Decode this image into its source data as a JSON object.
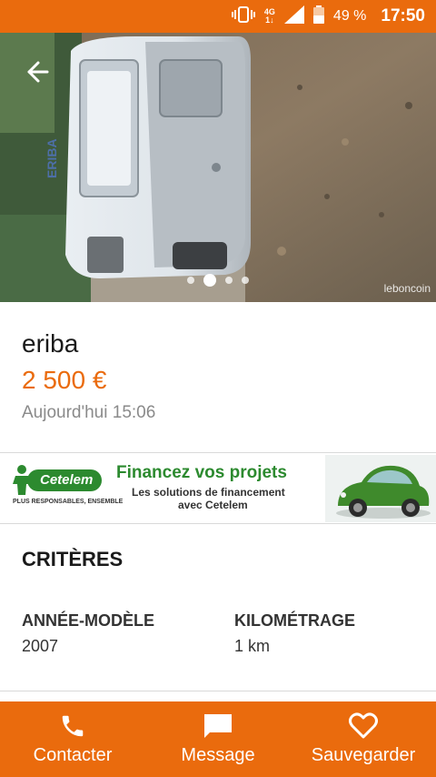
{
  "status_bar": {
    "network_top": "4G",
    "network_bottom": "1↓",
    "battery": "49 %",
    "time": "17:50"
  },
  "photo": {
    "watermark": "leboncoin",
    "caravan_brand": "ERIBA",
    "dots": 4,
    "active_dot": 1
  },
  "listing": {
    "title": "eriba",
    "price": "2 500 €",
    "date": "Aujourd'hui 15:06"
  },
  "ad": {
    "brand": "Cetelem",
    "tagline": "PLUS RESPONSABLES, ENSEMBLE",
    "headline": "Financez vos projets",
    "sub1": "Les solutions de financement",
    "sub2": "avec Cetelem"
  },
  "criteria": {
    "title": "CRITÈRES",
    "items": [
      {
        "label": "ANNÉE-MODÈLE",
        "value": "2007"
      },
      {
        "label": "KILOMÉTRAGE",
        "value": "1 km"
      }
    ]
  },
  "actions": {
    "contact": "Contacter",
    "message": "Message",
    "save": "Sauvegarder"
  },
  "icons": {
    "back": "back-arrow-icon",
    "vibrate": "vibrate-icon",
    "signal": "signal-icon",
    "battery": "battery-icon",
    "phone": "phone-icon",
    "message": "message-icon",
    "heart": "heart-icon"
  },
  "colors": {
    "accent": "#ea6b0d",
    "ad_green": "#2c8a2f",
    "muted_text": "#8a8a8a"
  }
}
